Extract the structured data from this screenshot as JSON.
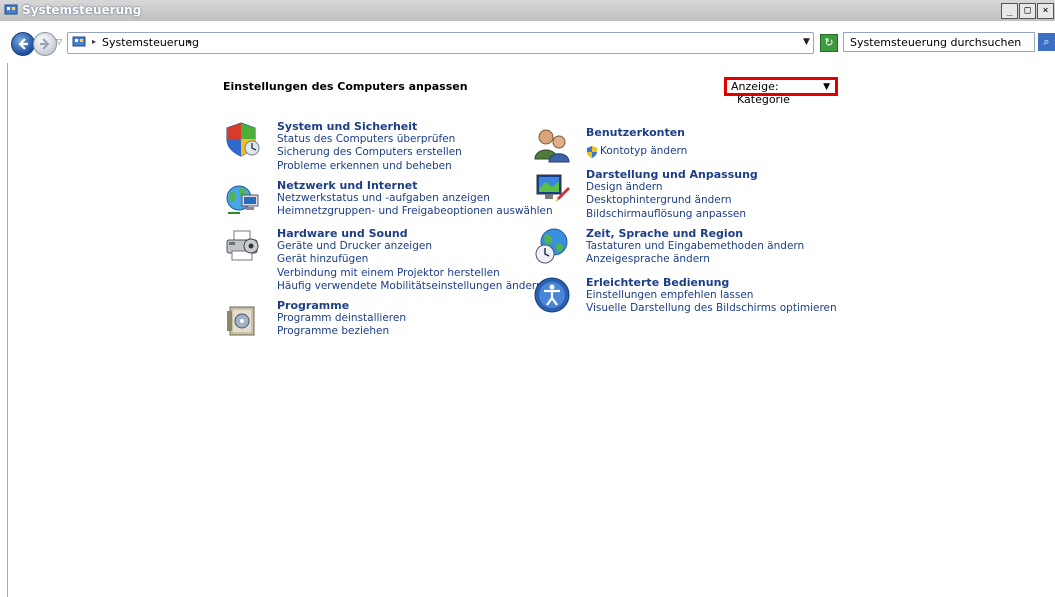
{
  "window": {
    "title": "Systemsteuerung"
  },
  "address": {
    "crumb": "Systemsteuerung"
  },
  "search": {
    "placeholder": "Systemsteuerung durchsuchen"
  },
  "main": {
    "heading": "Einstellungen des Computers anpassen",
    "view": {
      "label": "Anzeige:",
      "value": "Kategorie"
    },
    "left": [
      {
        "title": "System und Sicherheit",
        "links": [
          "Status des Computers überprüfen",
          "Sicherung des Computers erstellen",
          "Probleme erkennen und beheben"
        ]
      },
      {
        "title": "Netzwerk und Internet",
        "links": [
          "Netzwerkstatus und -aufgaben anzeigen",
          "Heimnetzgruppen- und Freigabeoptionen auswählen"
        ]
      },
      {
        "title": "Hardware und Sound",
        "links": [
          "Geräte und Drucker anzeigen",
          "Gerät hinzufügen",
          "Verbindung mit einem Projektor herstellen",
          "Häufig verwendete Mobilitätseinstellungen ändern"
        ]
      },
      {
        "title": "Programme",
        "links": [
          "Programm deinstallieren",
          "Programme beziehen"
        ]
      }
    ],
    "right": [
      {
        "title": "Benutzerkonten",
        "links": [
          "Kontotyp ändern"
        ]
      },
      {
        "title": "Darstellung und Anpassung",
        "links": [
          "Design ändern",
          "Desktophintergrund ändern",
          "Bildschirmauflösung anpassen"
        ]
      },
      {
        "title": "Zeit, Sprache und Region",
        "links": [
          "Tastaturen und Eingabemethoden ändern",
          "Anzeigesprache ändern"
        ]
      },
      {
        "title": "Erleichterte Bedienung",
        "links": [
          "Einstellungen empfehlen lassen",
          "Visuelle Darstellung des Bildschirms optimieren"
        ]
      }
    ]
  },
  "icons": {
    "system": "security-shield-icon",
    "network": "network-globe-icon",
    "hardware": "printer-icon",
    "programs": "programs-box-icon",
    "users": "users-icon",
    "appearance": "display-icon",
    "clock": "globe-clock-icon",
    "access": "accessibility-icon"
  }
}
